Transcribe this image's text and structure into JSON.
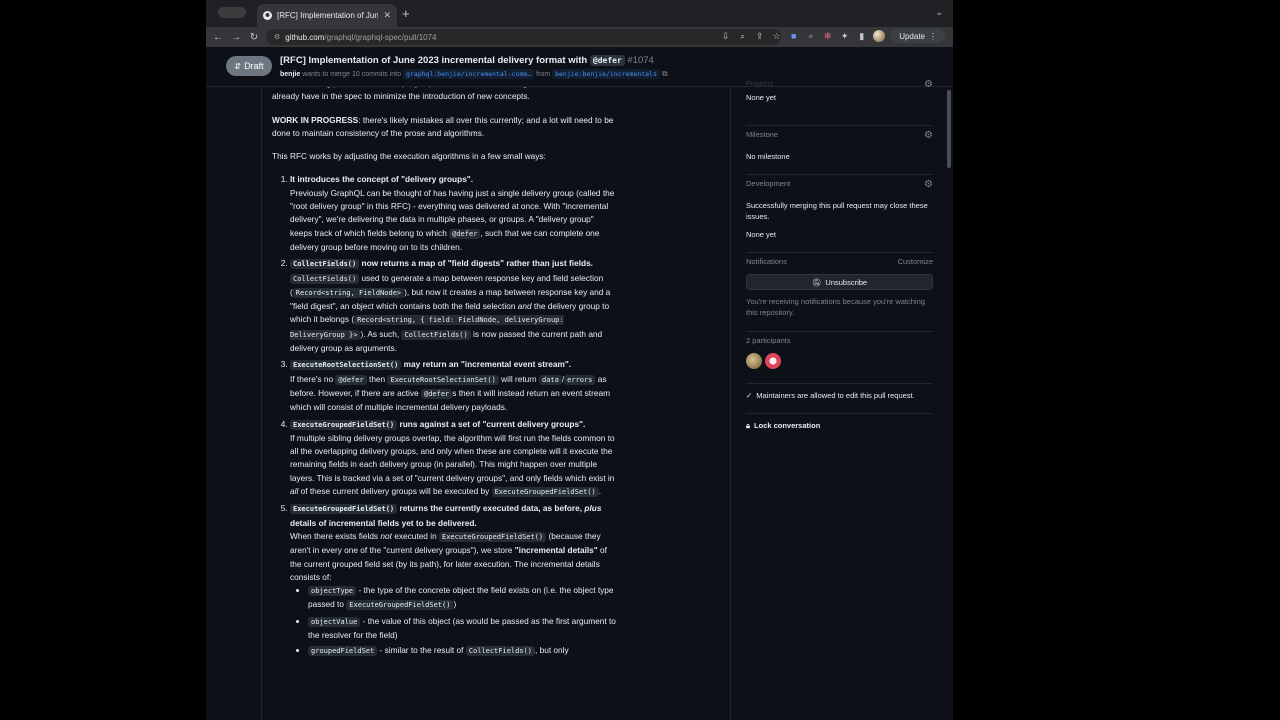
{
  "browser": {
    "tab_title": "[RFC] Implementation of June",
    "url_host": "github.com",
    "url_path": "/graphql/graphql-spec/pull/1074",
    "update_label": "Update"
  },
  "pr": {
    "state": "Draft",
    "title": "[RFC] Implementation of June 2023 incremental delivery format with",
    "title_code": "@defer",
    "number": "#1074",
    "author": "benjie",
    "merge_text": "wants to merge 10 commits into",
    "base_branch": "graphql:benjie/incremental-comm…",
    "from_text": "from",
    "head_branch": "benjie:benjie/incrementals"
  },
  "body": {
    "intro1": "with the existing patterns in the GraphQL spec. It also aims to leverage the features we already have in the spec to minimize the introduction of new concepts.",
    "wip_bold": "WORK IN PROGRESS",
    "wip_rest": ": there's likely mistakes all over this currently; and a lot will need to be done to maintain consistency of the prose and algorithms.",
    "intro2": "This RFC works by adjusting the execution algorithms in a few small ways:",
    "i1_title": "It introduces the concept of \"delivery groups\".",
    "i1_text_a": "Previously GraphQL can be thought of has having just a single delivery group (called the \"root delivery group\" in this RFC) - everything was delivered at once. With \"incremental delivery\", we're delivering the data in multiple phases, or groups. A \"delivery group\" keeps track of which fields belong to which",
    "i1_code": "@defer",
    "i1_text_b": ", such that we can complete one delivery group before moving on to its children.",
    "i2_code": "CollectFields()",
    "i2_title": "now returns a map of \"field digests\" rather than just fields.",
    "i2_code2": "CollectFields()",
    "i2_text_a": "used to generate a map between response key and field selection (",
    "i2_code3": "Record<string, FieldNode>",
    "i2_text_b": "), but now it creates a map between response key and a \"field digest\", an object which contains both the field selection",
    "i2_and": "and",
    "i2_text_c": "the delivery group to which it belongs (",
    "i2_code4": "Record<string, { field: FieldNode, deliveryGroup: DeliveryGroup }>",
    "i2_text_d": "). As such,",
    "i2_code5": "CollectFields()",
    "i2_text_e": "is now passed the current path and delivery group as arguments.",
    "i3_code": "ExecuteRootSelectionSet()",
    "i3_title": "may return an \"incremental event stream\".",
    "i3_text_a": "If there's no",
    "i3_code2": "@defer",
    "i3_text_b": "then",
    "i3_code3": "ExecuteRootSelectionSet()",
    "i3_text_c": "will return",
    "i3_code4": "data",
    "i3_slash": "/",
    "i3_code5": "errors",
    "i3_text_d": "as before. However, if there are active",
    "i3_code6": "@defer",
    "i3_text_e": "s then it will instead return an event stream which will consist of multiple incremental delivery payloads.",
    "i4_code": "ExecuteGroupedFieldSet()",
    "i4_title": "runs against a set of \"current delivery groups\".",
    "i4_text_a": "If multiple sibling delivery groups overlap, the algorithm will first run the fields common to all the overlapping delivery groups, and only when these are complete will it execute the remaining fields in each delivery group (in parallel). This might happen over multiple layers. This is tracked via a set of \"current delivery groups\", and only fields which exist in",
    "i4_all": "all",
    "i4_text_b": "of these current delivery groups will be executed by",
    "i4_code2": "ExecuteGroupedFieldSet()",
    "i4_dot": ".",
    "i5_code": "ExecuteGroupedFieldSet()",
    "i5_title": "returns the currently executed data, as before,",
    "i5_plus": "plus",
    "i5_title_b": "details of incremental fields yet to be delivered.",
    "i5_text_a": "When there exists fields",
    "i5_not": "not",
    "i5_text_b": "executed in",
    "i5_code2": "ExecuteGroupedFieldSet()",
    "i5_text_c": "(because they aren't in every one of the \"current delivery groups\"), we store",
    "i5_bold": "\"incremental details\"",
    "i5_text_d": "of the current grouped field set (by its path), for later execution. The incremental details consists of:",
    "s1_code": "objectType",
    "s1_text": "- the type of the concrete object the field exists on (i.e. the object type passed to",
    "s1_code2": "ExecuteGroupedFieldSet()",
    "s1_end": ")",
    "s2_code": "objectValue",
    "s2_text": "- the value of this object (as would be passed as the first argument to the resolver for the field)",
    "s3_code": "groupedFieldSet",
    "s3_text": "- similar to the result of",
    "s3_code2": "CollectFields()",
    "s3_text_b": ", but only"
  },
  "sidebar": {
    "projects_label": "Projects",
    "projects_value": "None yet",
    "milestone_label": "Milestone",
    "milestone_value": "No milestone",
    "development_label": "Development",
    "development_text": "Successfully merging this pull request may close these issues.",
    "development_value": "None yet",
    "notifications_label": "Notifications",
    "customize_label": "Customize",
    "unsubscribe_label": "Unsubscribe",
    "notif_text": "You're receiving notifications because you're watching this repository.",
    "participants_label": "2 participants",
    "maintainers_text": "Maintainers are allowed to edit this pull request.",
    "lock_label": "Lock conversation"
  }
}
